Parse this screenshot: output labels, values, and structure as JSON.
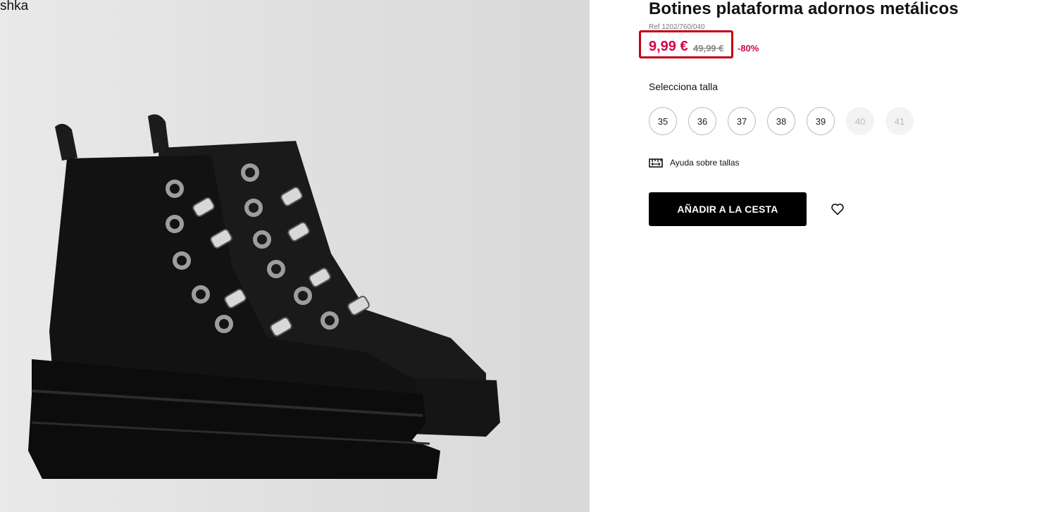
{
  "image_panel": {
    "brand_fragment": "shka"
  },
  "product": {
    "title": "Botines plataforma adornos metálicos",
    "ref": "Ref 1202/760/040",
    "price_current": "9,99 €",
    "price_old": "49,99 €",
    "discount": "-80%",
    "highlight_color": "#c20012",
    "sale_color": "#d1064a"
  },
  "sizes": {
    "label": "Selecciona talla",
    "options": [
      {
        "value": "35",
        "available": true
      },
      {
        "value": "36",
        "available": true
      },
      {
        "value": "37",
        "available": true
      },
      {
        "value": "38",
        "available": true
      },
      {
        "value": "39",
        "available": true
      },
      {
        "value": "40",
        "available": false
      },
      {
        "value": "41",
        "available": false
      }
    ],
    "help_label": "Ayuda sobre tallas",
    "help_icon": "ruler-icon"
  },
  "actions": {
    "add_to_cart_label": "AÑADIR A LA CESTA",
    "wishlist_icon": "heart-icon"
  }
}
